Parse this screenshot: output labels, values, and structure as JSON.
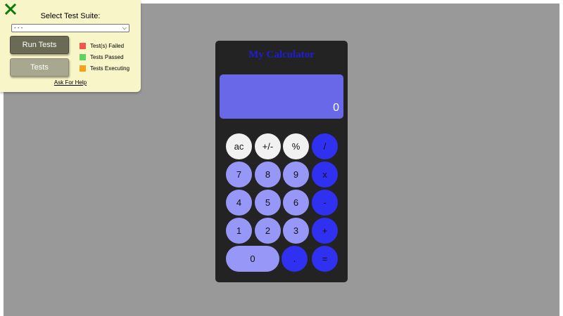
{
  "test_panel": {
    "suite_label": "Select Test Suite:",
    "suite_selected": "- - -",
    "run_label": "Run Tests",
    "tests_label": "Tests",
    "legend": [
      {
        "label": "Test(s) Failed",
        "color": "#f0574a"
      },
      {
        "label": "Tests Passed",
        "color": "#5fd35f"
      },
      {
        "label": "Tests Executing",
        "color": "#f5a219"
      }
    ],
    "help_label": "Ask For Help",
    "close_color": "#0a7a0a"
  },
  "calculator": {
    "title": "My Calculator",
    "display_value": "0",
    "keys": {
      "ac": "ac",
      "sign": "+/-",
      "percent": "%",
      "divide": "/",
      "seven": "7",
      "eight": "8",
      "nine": "9",
      "multiply": "x",
      "four": "4",
      "five": "5",
      "six": "6",
      "subtract": "-",
      "one": "1",
      "two": "2",
      "three": "3",
      "add": "+",
      "zero": "0",
      "decimal": ".",
      "equals": "="
    }
  }
}
